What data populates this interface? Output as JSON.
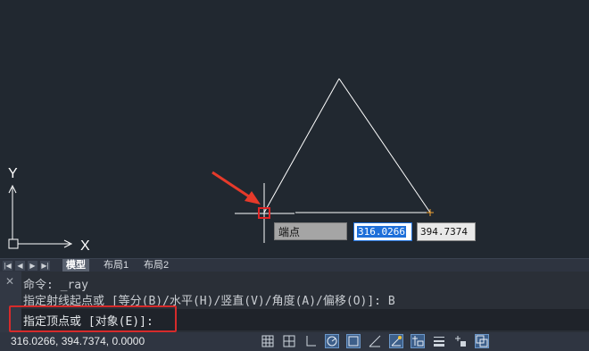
{
  "canvas": {
    "ucs_x_label": "X",
    "ucs_y_label": "Y",
    "osnap_tooltip": "端点",
    "input_x": "316.0266",
    "input_y": "394.7374"
  },
  "tabs": {
    "items": [
      {
        "label": "模型",
        "active": true
      },
      {
        "label": "布局1",
        "active": false
      },
      {
        "label": "布局2",
        "active": false
      }
    ]
  },
  "command": {
    "history": [
      "命令: _ray",
      "指定射线起点或 [等分(B)/水平(H)/竖直(V)/角度(A)/偏移(O)]: B"
    ],
    "prompt": "指定顶点或 [对象(E)]:"
  },
  "status": {
    "coordinates": "316.0266, 394.7374, 0.0000",
    "icons": [
      "grid-icon",
      "snap-icon",
      "ortho-icon",
      "polar-icon",
      "osnap-icon",
      "otrack-icon",
      "dynucs-icon",
      "dyninput-icon",
      "lineweight-icon",
      "transparency-icon",
      "selection-cycling-icon"
    ]
  },
  "colors": {
    "canvas": "#212830",
    "highlight": "#d62b2b",
    "accent": "#1e6fd9"
  }
}
